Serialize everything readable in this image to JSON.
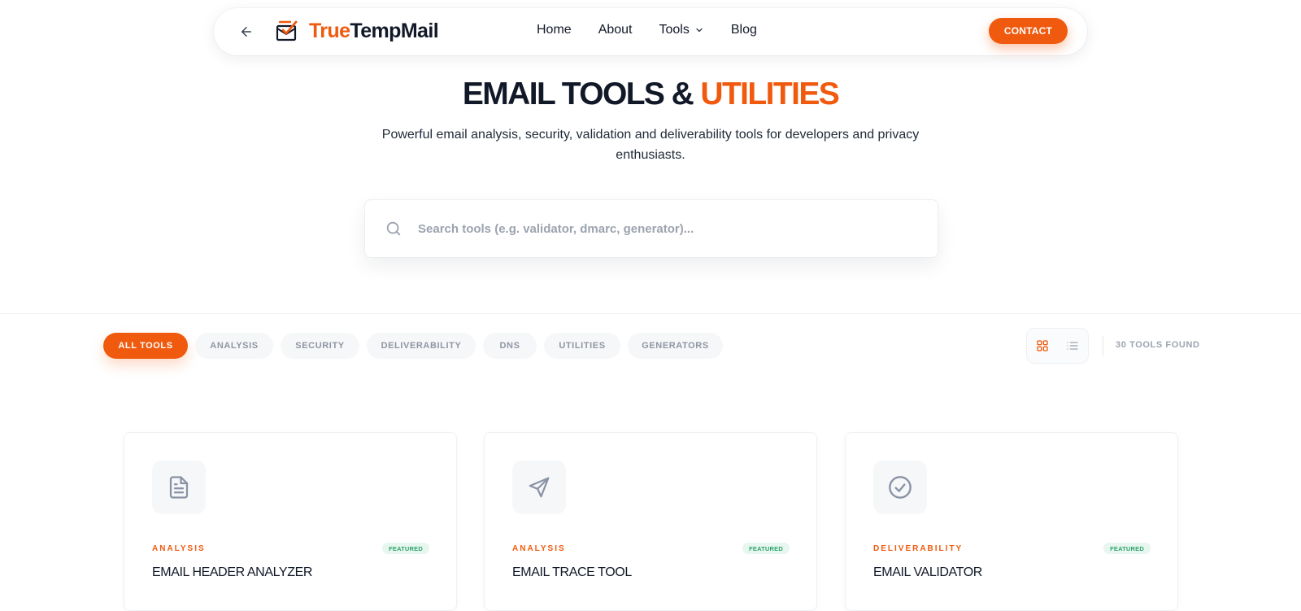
{
  "nav": {
    "brand_part1": "True",
    "brand_part2": "TempMail",
    "links": [
      {
        "label": "Home"
      },
      {
        "label": "About"
      },
      {
        "label": "Tools"
      },
      {
        "label": "Blog"
      }
    ],
    "contact_label": "CONTACT"
  },
  "hero": {
    "title_main": "EMAIL TOOLS & ",
    "title_accent": "UTILITIES",
    "subtitle": "Powerful email analysis, security, validation and deliverability tools for developers and privacy enthusiasts."
  },
  "search": {
    "placeholder": "Search tools (e.g. validator, dmarc, generator)...",
    "value": ""
  },
  "filters": {
    "chips": [
      {
        "label": "ALL TOOLS",
        "active": true
      },
      {
        "label": "ANALYSIS",
        "active": false
      },
      {
        "label": "SECURITY",
        "active": false
      },
      {
        "label": "DELIVERABILITY",
        "active": false
      },
      {
        "label": "DNS",
        "active": false
      },
      {
        "label": "UTILITIES",
        "active": false
      },
      {
        "label": "GENERATORS",
        "active": false
      }
    ],
    "view_mode": "grid",
    "count_label": "30 TOOLS FOUND"
  },
  "cards": [
    {
      "icon": "document-icon",
      "category": "ANALYSIS",
      "badge": "FEATURED",
      "title": "EMAIL HEADER ANALYZER"
    },
    {
      "icon": "send-icon",
      "category": "ANALYSIS",
      "badge": "FEATURED",
      "title": "EMAIL TRACE TOOL"
    },
    {
      "icon": "check-circle-icon",
      "category": "DELIVERABILITY",
      "badge": "FEATURED",
      "title": "EMAIL VALIDATOR"
    }
  ],
  "colors": {
    "accent": "#f05a0e",
    "text": "#111827",
    "muted": "#9ca3af",
    "featured_bg": "#e7f6ee",
    "featured_text": "#2fa36b"
  }
}
